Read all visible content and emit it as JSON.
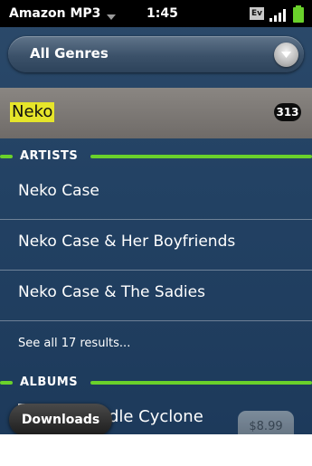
{
  "statusbar": {
    "app_title": "Amazon MP3",
    "time": "1:45",
    "network_badge": "Ev",
    "icons": [
      "chevron-down-icon",
      "signal-bars-icon",
      "battery-icon"
    ]
  },
  "genre_filter": {
    "selected": "All Genres",
    "icon": "chevron-down-icon"
  },
  "search": {
    "query": "Neko",
    "result_count": "313",
    "highlight_color": "#e6e52a"
  },
  "sections": {
    "artists": {
      "title": "ARTISTS",
      "items": [
        {
          "label": "Neko Case"
        },
        {
          "label": "Neko Case & Her Boyfriends"
        },
        {
          "label": "Neko Case & The Sadies"
        }
      ],
      "see_all": "See all 17 results..."
    },
    "albums": {
      "title": "ALBUMS",
      "items": [
        {
          "title": "Middle Cyclone",
          "price": "$8.99"
        }
      ]
    }
  },
  "bottom_bar": {
    "downloads_label": "Downloads"
  },
  "colors": {
    "accent_green": "#6ad12b",
    "background_blue": "#234264"
  }
}
